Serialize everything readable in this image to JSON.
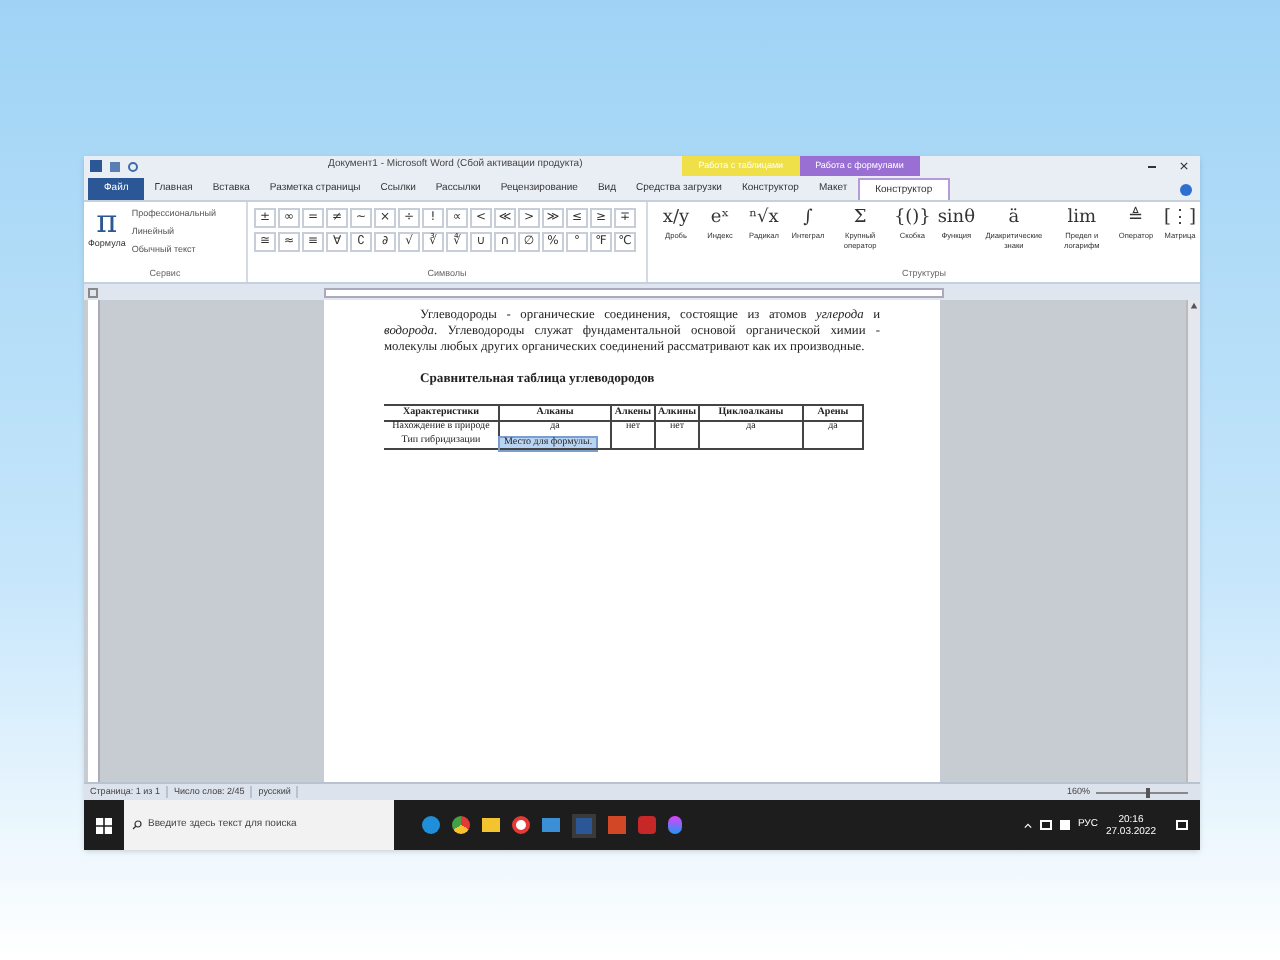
{
  "window": {
    "title": "Документ1 - Microsoft Word (Сбой активации продукта)"
  },
  "context_tabs": [
    {
      "label": "Работа с таблицами",
      "color": "#efe04a"
    },
    {
      "label": "Работа с формулами",
      "color": "#9a6fd3"
    }
  ],
  "tabs": [
    {
      "label": "Файл",
      "selected": false,
      "kind": "file"
    },
    {
      "label": "Главная",
      "selected": false,
      "kind": "plain"
    },
    {
      "label": "Вставка",
      "selected": false,
      "kind": "plain"
    },
    {
      "label": "Разметка страницы",
      "selected": false,
      "kind": "plain"
    },
    {
      "label": "Ссылки",
      "selected": false,
      "kind": "plain"
    },
    {
      "label": "Рассылки",
      "selected": false,
      "kind": "plain"
    },
    {
      "label": "Рецензирование",
      "selected": false,
      "kind": "plain"
    },
    {
      "label": "Вид",
      "selected": false,
      "kind": "plain"
    },
    {
      "label": "Средства загрузки",
      "selected": false,
      "kind": "plain"
    },
    {
      "label": "Конструктор",
      "selected": false,
      "kind": "context"
    },
    {
      "label": "Макет",
      "selected": false,
      "kind": "context"
    },
    {
      "label": "Конструктор",
      "selected": true,
      "kind": "context"
    }
  ],
  "ribbon": {
    "service": {
      "caption": "Сервис",
      "button": "Формула",
      "glyph": "π",
      "options": [
        "Профессиональный",
        "Линейный",
        "Обычный текст"
      ]
    },
    "symbols": {
      "caption": "Символы",
      "rows": [
        [
          "±",
          "∞",
          "=",
          "≠",
          "~",
          "×",
          "÷",
          "!",
          "∝",
          "<",
          "≪",
          ">",
          "≫",
          "≤",
          "≥",
          "∓"
        ],
        [
          "≅",
          "≈",
          "≡",
          "∀",
          "∁",
          "∂",
          "√",
          "∛",
          "∜",
          "∪",
          "∩",
          "∅",
          "%",
          "°",
          "℉",
          "℃"
        ]
      ]
    },
    "structures": {
      "caption": "Структуры",
      "items": [
        {
          "glyph": "x/y",
          "label": "Дробь"
        },
        {
          "glyph": "eˣ",
          "label": "Индекс"
        },
        {
          "glyph": "ⁿ√x",
          "label": "Радикал"
        },
        {
          "glyph": "∫",
          "label": "Интеграл"
        },
        {
          "glyph": "Σ",
          "label": "Крупный оператор"
        },
        {
          "glyph": "{()}",
          "label": "Скобка"
        },
        {
          "glyph": "sinθ",
          "label": "Функция"
        },
        {
          "glyph": "ä",
          "label": "Диакритические знаки"
        },
        {
          "glyph": "lim",
          "label": "Предел и логарифм"
        },
        {
          "glyph": "≜",
          "label": "Оператор"
        },
        {
          "glyph": "[⋮]",
          "label": "Матрица"
        }
      ]
    }
  },
  "document": {
    "paragraph": "Углеводороды - органические соединения, состоящие из атомов *углерода* и *водорода*. Углеводороды служат фундаментальной основой органической химии - молекулы любых других органических соединений рассматривают как их производные.",
    "heading": "Сравнительная таблица углеводородов",
    "table": {
      "columns": [
        "Характеристики",
        "Алканы",
        "Алкены",
        "Алкины",
        "Циклоалканы",
        "Арены"
      ],
      "rows": [
        {
          "cells": [
            "Нахождение в природе",
            "да",
            "нет",
            "нет",
            "да",
            "да"
          ]
        },
        {
          "cells": [
            "Тип гибридизации",
            "",
            "",
            "",
            "",
            ""
          ],
          "formula_placeholder": "Место для формулы."
        }
      ]
    }
  },
  "status_bar": {
    "items": [
      "Страница: 1 из 1",
      "Число слов: 2/45",
      "русский"
    ],
    "zoom": "160%",
    "level": 0.55
  },
  "taskbar": {
    "search_placeholder": "Введите здесь текст для поиска",
    "lang": "РУС",
    "time": "20:16",
    "date": "27.03.2022"
  }
}
